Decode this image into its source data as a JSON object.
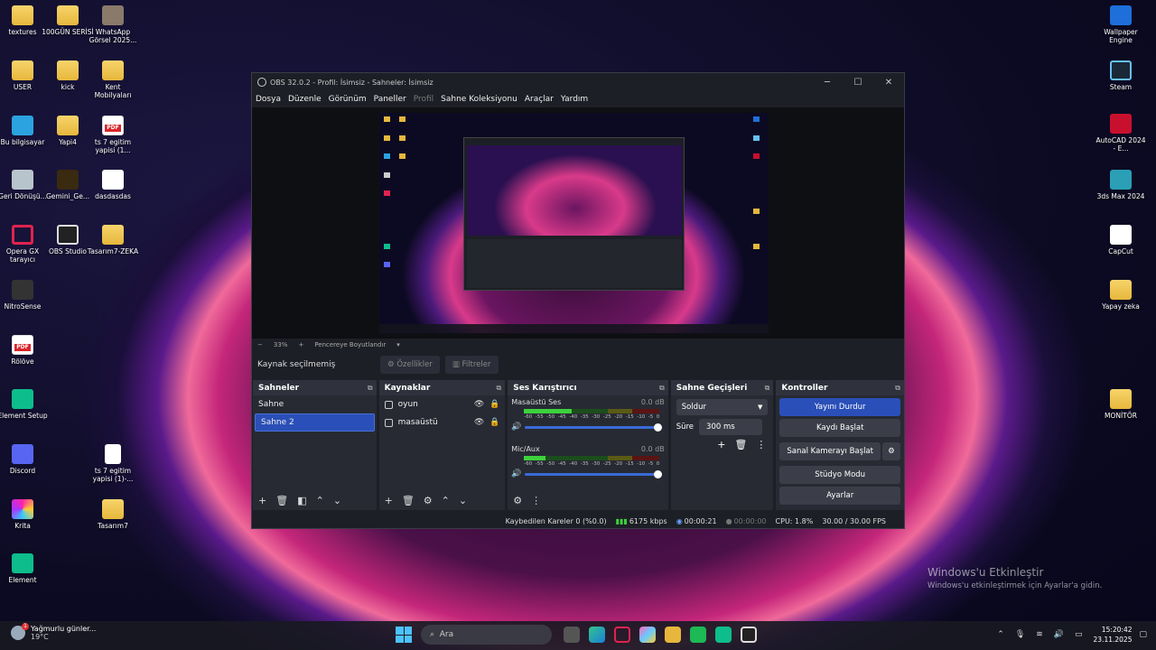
{
  "desktop": {
    "left_icons": [
      {
        "label": "textures"
      },
      {
        "label": "100GÜN SERİSİ"
      },
      {
        "label": "WhatsApp Görsel 2025..."
      },
      {
        "label": "USER"
      },
      {
        "label": "kick"
      },
      {
        "label": "Kent Mobilyaları"
      },
      {
        "label": "Bu bilgisayar"
      },
      {
        "label": "Yapi4"
      },
      {
        "label": "ts 7 egitim yapisi (1..."
      },
      {
        "label": "Geri Dönüşü..."
      },
      {
        "label": "Gemini_Ge..."
      },
      {
        "label": "dasdasdas"
      },
      {
        "label": "Opera GX tarayıcı"
      },
      {
        "label": "OBS Studio"
      },
      {
        "label": "Tasarım7-ZEKA"
      },
      {
        "label": "NitroSense"
      },
      {
        "label": "Rölöve"
      },
      {
        "label": "Element Setup"
      },
      {
        "label": "Discord"
      },
      {
        "label": "ts 7 egitim yapisi (1)-..."
      },
      {
        "label": "Krita"
      },
      {
        "label": "Tasarım7"
      },
      {
        "label": "Element"
      }
    ],
    "right_icons": [
      {
        "label": "Wallpaper Engine"
      },
      {
        "label": "Steam"
      },
      {
        "label": "AutoCAD 2024 - E..."
      },
      {
        "label": "3ds Max 2024"
      },
      {
        "label": "CapCut"
      },
      {
        "label": "Yapay zeka"
      },
      {
        "label": "MONİTÖR"
      }
    ]
  },
  "obs": {
    "title": "OBS 32.0.2 - Profil: İsimsiz - Sahneler: İsimsiz",
    "menu": [
      "Dosya",
      "Düzenle",
      "Görünüm",
      "Paneller",
      "Profil",
      "Sahne Koleksiyonu",
      "Araçlar",
      "Yardım"
    ],
    "zoom": {
      "minus": "−",
      "value": "33%",
      "plus": "+",
      "fit": "Pencereye Boyutlandır"
    },
    "source_bar": {
      "no_selection": "Kaynak seçilmemiş",
      "properties": "Özellikler",
      "filters": "Filtreler"
    },
    "scenes": {
      "title": "Sahneler",
      "items": [
        "Sahne",
        "Sahne 2"
      ]
    },
    "sources": {
      "title": "Kaynaklar",
      "items": [
        "oyun",
        "masaüstü"
      ]
    },
    "mixer": {
      "title": "Ses Karıştırıcı",
      "channels": [
        {
          "name": "Masaüstü Ses",
          "db": "0.0 dB",
          "level": 0.35
        },
        {
          "name": "Mic/Aux",
          "db": "0.0 dB",
          "level": 0.16
        }
      ],
      "ticks": [
        "-60",
        "-55",
        "-50",
        "-45",
        "-40",
        "-35",
        "-30",
        "-25",
        "-20",
        "-15",
        "-10",
        "-5",
        "0"
      ]
    },
    "transitions": {
      "title": "Sahne Geçişleri",
      "selected": "Soldur",
      "duration_label": "Süre",
      "duration": "300 ms"
    },
    "controls": {
      "title": "Kontroller",
      "stop_stream": "Yayını Durdur",
      "start_record": "Kaydı Başlat",
      "virtual_cam": "Sanal Kamerayı Başlat",
      "studio_mode": "Stüdyo Modu",
      "settings": "Ayarlar"
    },
    "status": {
      "dropped": "Kaybedilen Kareler 0 (%0.0)",
      "bitrate": "6175 kbps",
      "stream_time": "00:00:21",
      "rec_time": "00:00:00",
      "cpu": "CPU: 1.8%",
      "fps": "30.00 / 30.00 FPS"
    }
  },
  "watermark": {
    "line1": "Windows'u Etkinleştir",
    "line2": "Windows'u etkinleştirmek için Ayarlar'a gidin."
  },
  "taskbar": {
    "weather_text": "Yağmurlu günler...",
    "weather_temp": "19°C",
    "weather_badge": "1",
    "search_placeholder": "Ara",
    "time": "15:20:42",
    "date": "23.11.2025"
  }
}
